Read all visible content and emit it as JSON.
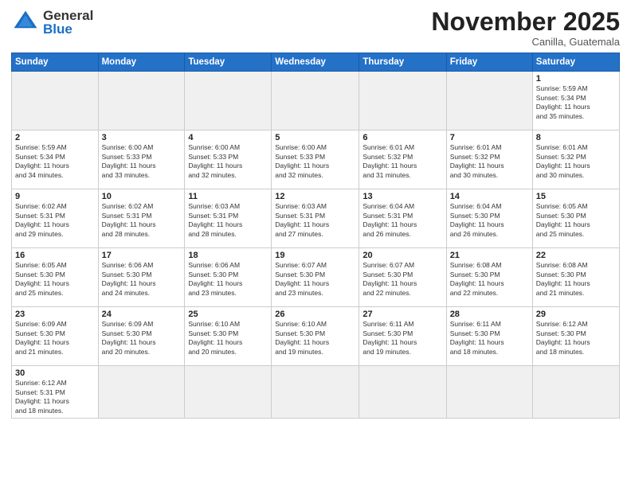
{
  "header": {
    "logo_general": "General",
    "logo_blue": "Blue",
    "month_title": "November 2025",
    "location": "Canilla, Guatemala"
  },
  "weekdays": [
    "Sunday",
    "Monday",
    "Tuesday",
    "Wednesday",
    "Thursday",
    "Friday",
    "Saturday"
  ],
  "weeks": [
    [
      {
        "day": "",
        "info": ""
      },
      {
        "day": "",
        "info": ""
      },
      {
        "day": "",
        "info": ""
      },
      {
        "day": "",
        "info": ""
      },
      {
        "day": "",
        "info": ""
      },
      {
        "day": "",
        "info": ""
      },
      {
        "day": "1",
        "info": "Sunrise: 5:59 AM\nSunset: 5:34 PM\nDaylight: 11 hours\nand 35 minutes."
      }
    ],
    [
      {
        "day": "2",
        "info": "Sunrise: 5:59 AM\nSunset: 5:34 PM\nDaylight: 11 hours\nand 34 minutes."
      },
      {
        "day": "3",
        "info": "Sunrise: 6:00 AM\nSunset: 5:33 PM\nDaylight: 11 hours\nand 33 minutes."
      },
      {
        "day": "4",
        "info": "Sunrise: 6:00 AM\nSunset: 5:33 PM\nDaylight: 11 hours\nand 32 minutes."
      },
      {
        "day": "5",
        "info": "Sunrise: 6:00 AM\nSunset: 5:33 PM\nDaylight: 11 hours\nand 32 minutes."
      },
      {
        "day": "6",
        "info": "Sunrise: 6:01 AM\nSunset: 5:32 PM\nDaylight: 11 hours\nand 31 minutes."
      },
      {
        "day": "7",
        "info": "Sunrise: 6:01 AM\nSunset: 5:32 PM\nDaylight: 11 hours\nand 30 minutes."
      },
      {
        "day": "8",
        "info": "Sunrise: 6:01 AM\nSunset: 5:32 PM\nDaylight: 11 hours\nand 30 minutes."
      }
    ],
    [
      {
        "day": "9",
        "info": "Sunrise: 6:02 AM\nSunset: 5:31 PM\nDaylight: 11 hours\nand 29 minutes."
      },
      {
        "day": "10",
        "info": "Sunrise: 6:02 AM\nSunset: 5:31 PM\nDaylight: 11 hours\nand 28 minutes."
      },
      {
        "day": "11",
        "info": "Sunrise: 6:03 AM\nSunset: 5:31 PM\nDaylight: 11 hours\nand 28 minutes."
      },
      {
        "day": "12",
        "info": "Sunrise: 6:03 AM\nSunset: 5:31 PM\nDaylight: 11 hours\nand 27 minutes."
      },
      {
        "day": "13",
        "info": "Sunrise: 6:04 AM\nSunset: 5:31 PM\nDaylight: 11 hours\nand 26 minutes."
      },
      {
        "day": "14",
        "info": "Sunrise: 6:04 AM\nSunset: 5:30 PM\nDaylight: 11 hours\nand 26 minutes."
      },
      {
        "day": "15",
        "info": "Sunrise: 6:05 AM\nSunset: 5:30 PM\nDaylight: 11 hours\nand 25 minutes."
      }
    ],
    [
      {
        "day": "16",
        "info": "Sunrise: 6:05 AM\nSunset: 5:30 PM\nDaylight: 11 hours\nand 25 minutes."
      },
      {
        "day": "17",
        "info": "Sunrise: 6:06 AM\nSunset: 5:30 PM\nDaylight: 11 hours\nand 24 minutes."
      },
      {
        "day": "18",
        "info": "Sunrise: 6:06 AM\nSunset: 5:30 PM\nDaylight: 11 hours\nand 23 minutes."
      },
      {
        "day": "19",
        "info": "Sunrise: 6:07 AM\nSunset: 5:30 PM\nDaylight: 11 hours\nand 23 minutes."
      },
      {
        "day": "20",
        "info": "Sunrise: 6:07 AM\nSunset: 5:30 PM\nDaylight: 11 hours\nand 22 minutes."
      },
      {
        "day": "21",
        "info": "Sunrise: 6:08 AM\nSunset: 5:30 PM\nDaylight: 11 hours\nand 22 minutes."
      },
      {
        "day": "22",
        "info": "Sunrise: 6:08 AM\nSunset: 5:30 PM\nDaylight: 11 hours\nand 21 minutes."
      }
    ],
    [
      {
        "day": "23",
        "info": "Sunrise: 6:09 AM\nSunset: 5:30 PM\nDaylight: 11 hours\nand 21 minutes."
      },
      {
        "day": "24",
        "info": "Sunrise: 6:09 AM\nSunset: 5:30 PM\nDaylight: 11 hours\nand 20 minutes."
      },
      {
        "day": "25",
        "info": "Sunrise: 6:10 AM\nSunset: 5:30 PM\nDaylight: 11 hours\nand 20 minutes."
      },
      {
        "day": "26",
        "info": "Sunrise: 6:10 AM\nSunset: 5:30 PM\nDaylight: 11 hours\nand 19 minutes."
      },
      {
        "day": "27",
        "info": "Sunrise: 6:11 AM\nSunset: 5:30 PM\nDaylight: 11 hours\nand 19 minutes."
      },
      {
        "day": "28",
        "info": "Sunrise: 6:11 AM\nSunset: 5:30 PM\nDaylight: 11 hours\nand 18 minutes."
      },
      {
        "day": "29",
        "info": "Sunrise: 6:12 AM\nSunset: 5:30 PM\nDaylight: 11 hours\nand 18 minutes."
      }
    ],
    [
      {
        "day": "30",
        "info": "Sunrise: 6:12 AM\nSunset: 5:31 PM\nDaylight: 11 hours\nand 18 minutes."
      },
      {
        "day": "",
        "info": ""
      },
      {
        "day": "",
        "info": ""
      },
      {
        "day": "",
        "info": ""
      },
      {
        "day": "",
        "info": ""
      },
      {
        "day": "",
        "info": ""
      },
      {
        "day": "",
        "info": ""
      }
    ]
  ]
}
